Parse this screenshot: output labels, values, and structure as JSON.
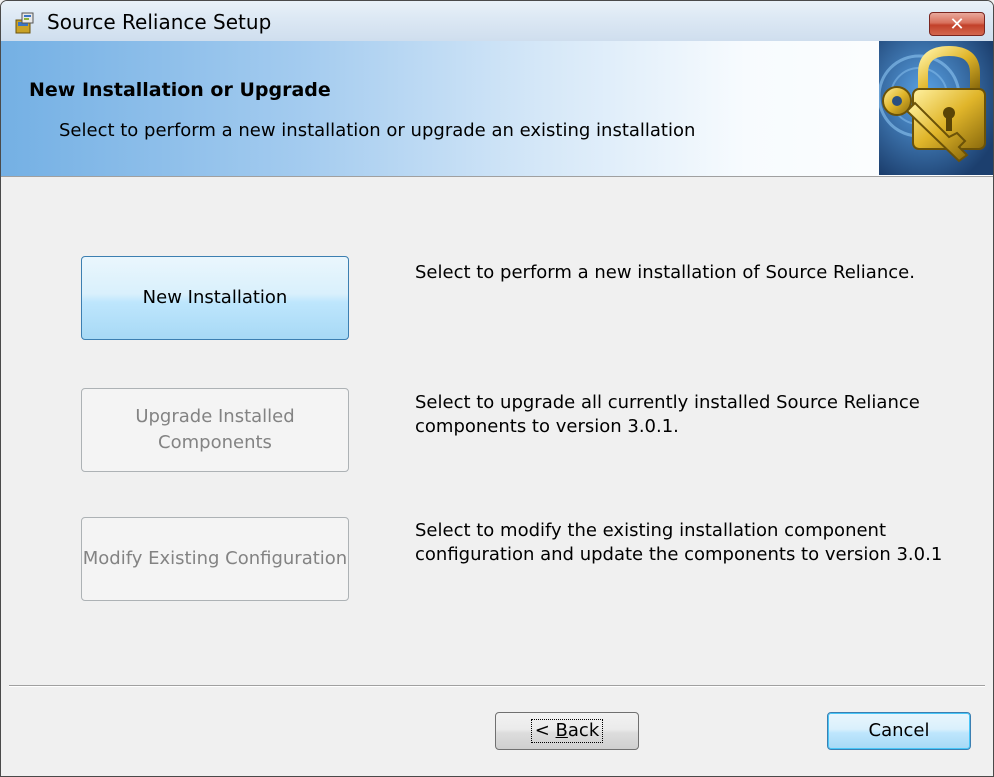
{
  "window": {
    "title": "Source Reliance Setup",
    "close_glyph": "✕"
  },
  "banner": {
    "title": "New Installation or Upgrade",
    "subtitle": "Select to perform a new installation or upgrade an existing installation",
    "image_icon": "padlock-key-icon"
  },
  "options": [
    {
      "label": "New Installation",
      "description": "Select to perform a new installation of Source Reliance.",
      "enabled": true
    },
    {
      "label": "Upgrade Installed Components",
      "description": "Select to upgrade all currently installed Source Reliance components to version 3.0.1.",
      "enabled": false
    },
    {
      "label": "Modify Existing Configuration",
      "description": "Select to modify the existing installation component configuration and update the components to version 3.0.1",
      "enabled": false
    }
  ],
  "footer": {
    "back_label_prefix": "< ",
    "back_label_accel": "B",
    "back_label_rest": "ack",
    "cancel_label": "Cancel"
  },
  "colors": {
    "accent": "#3c7fb1",
    "close_red": "#c2412a",
    "disabled_text": "#838383"
  }
}
